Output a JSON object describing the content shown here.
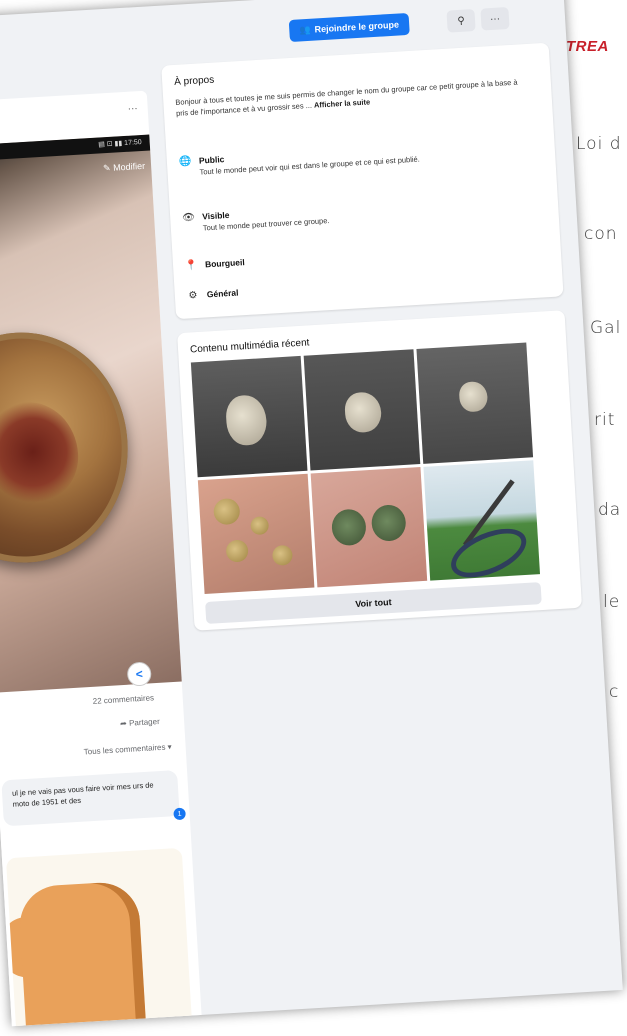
{
  "toolbar": {
    "join_label": "Rejoindre le groupe",
    "search_icon": "search-icon",
    "more_label": "···"
  },
  "post": {
    "more_label": "···",
    "status_bar": "▤ ⊡ ▮▮ 17:50",
    "modify_label": "Modifier",
    "comments_count": "22 commentaires",
    "share_label": "Partager",
    "comment_filter": "Tous les commentaires ▾",
    "comment_text": "ul je ne vais pas vous faire voir mes urs de moto de 1951 et des",
    "reaction_count": "1"
  },
  "about": {
    "title": "À propos",
    "description": "Bonjour à tous et toutes je me suis permis de changer le nom du groupe car ce petit groupe à la base à pris de l'importance et à vu grossir ses",
    "see_more": "Afficher la suite",
    "items": [
      {
        "icon": "globe-icon",
        "title": "Public",
        "text": "Tout le monde peut voir qui est dans le groupe et ce qui est publié."
      },
      {
        "icon": "eye-icon",
        "title": "Visible",
        "text": "Tout le monde peut trouver ce groupe."
      },
      {
        "icon": "location-pin-icon",
        "title": "Bourgueil",
        "text": ""
      },
      {
        "icon": "category-icon",
        "title": "Général",
        "text": ""
      }
    ]
  },
  "media": {
    "title": "Contenu multimédia récent",
    "see_all": "Voir tout"
  },
  "article": {
    "heading": "TREA",
    "lines": [
      "Loi d",
      "con",
      "Gal",
      "rit",
      "da",
      "le",
      "c"
    ]
  }
}
